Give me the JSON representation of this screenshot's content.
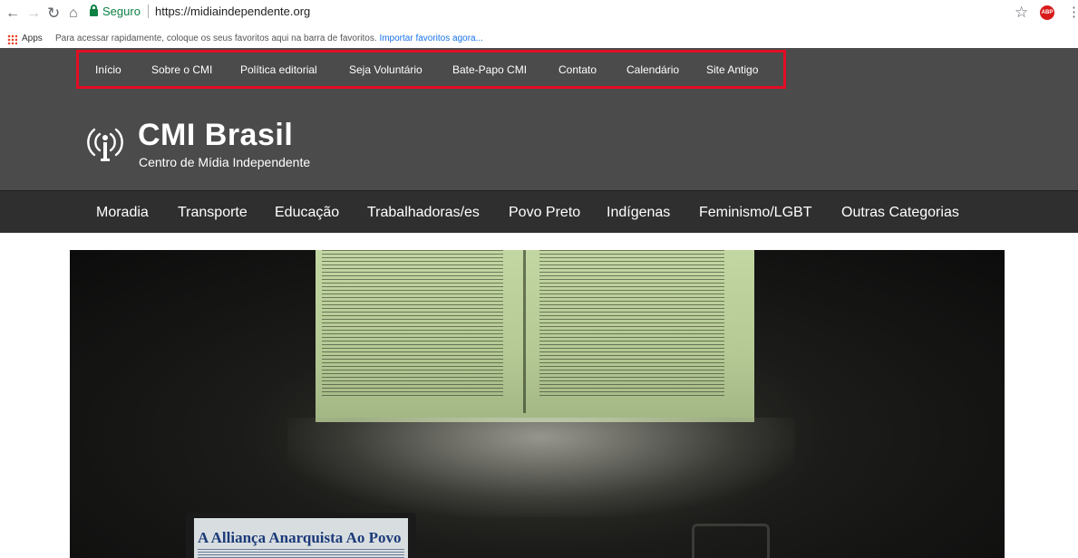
{
  "browser": {
    "secure_label": "Seguro",
    "url": "https://midiaindependente.org",
    "apps_label": "Apps",
    "bookmarks_hint": "Para acessar rapidamente, coloque os seus favoritos aqui na barra de favoritos.",
    "bookmarks_import": "Importar favoritos agora...",
    "extension_label": "ABP",
    "icons": [
      "back-icon",
      "forward-icon",
      "reload-icon",
      "home-icon",
      "lock-icon",
      "star-icon",
      "menu-icon"
    ]
  },
  "top_nav": {
    "items": [
      "Início",
      "Sobre o CMI",
      "Política editorial",
      "Seja Voluntário",
      "Bate-Papo CMI",
      "Contato",
      "Calendário",
      "Site Antigo"
    ],
    "highlight_color": "#e10e24"
  },
  "site": {
    "title": "CMI Brasil",
    "subtitle": "Centro de Mídia Independente",
    "header_color": "#4b4b4b"
  },
  "categories": {
    "items": [
      "Moradia",
      "Transporte",
      "Educação",
      "Trabalhadoras/es",
      "Povo Preto",
      "Indígenas",
      "Feminismo/LGBT",
      "Outras Categorias"
    ],
    "bar_color": "#2f2f2f"
  },
  "hero": {
    "laptop_headline": "A Alliança Anarquista Ao Povo"
  }
}
